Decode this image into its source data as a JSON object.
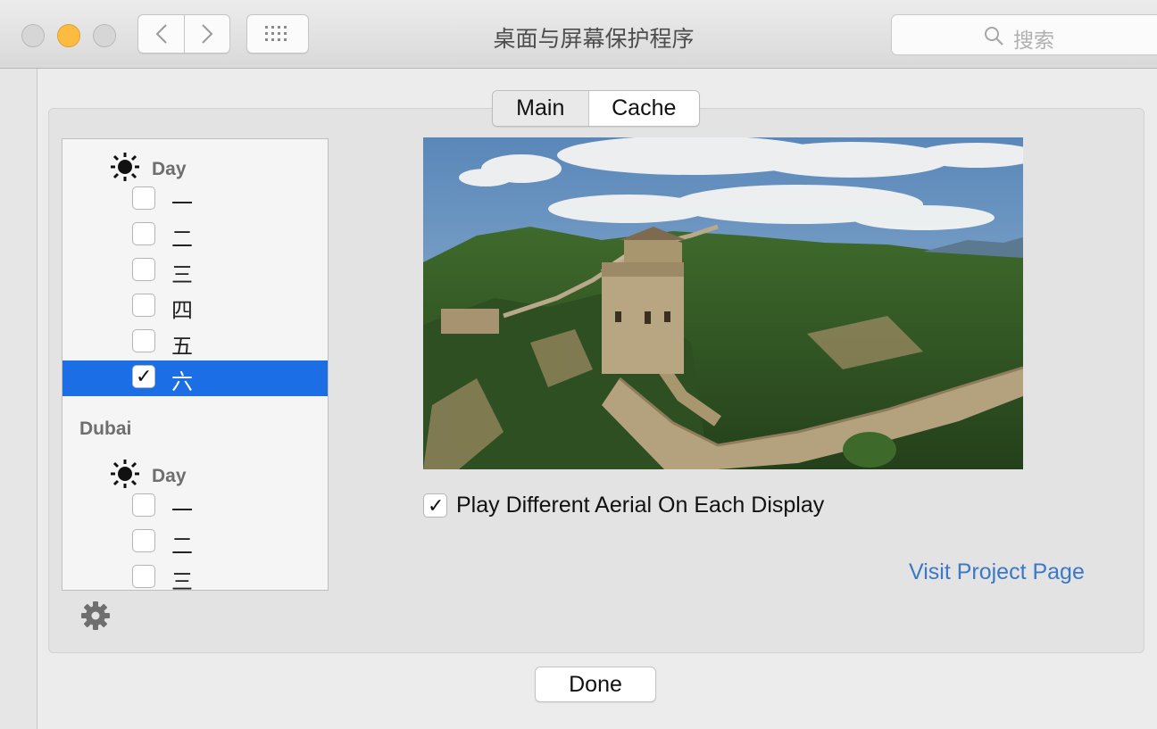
{
  "window": {
    "title": "桌面与屏幕保护程序",
    "search_placeholder": "搜索"
  },
  "tabs": [
    {
      "label": "Main",
      "selected": false
    },
    {
      "label": "Cache",
      "selected": true
    }
  ],
  "list": {
    "sections": [
      {
        "group": "",
        "time_label": "Day",
        "items": [
          {
            "label": "一",
            "checked": false
          },
          {
            "label": "二",
            "checked": false
          },
          {
            "label": "三",
            "checked": false
          },
          {
            "label": "四",
            "checked": false
          },
          {
            "label": "五",
            "checked": false
          },
          {
            "label": "六",
            "checked": true,
            "selected": true
          }
        ]
      },
      {
        "group": "Dubai",
        "time_label": "Day",
        "items": [
          {
            "label": "一",
            "checked": false
          },
          {
            "label": "二",
            "checked": false
          },
          {
            "label": "三",
            "checked": false
          }
        ]
      }
    ]
  },
  "options": {
    "play_different_label": "Play Different Aerial On Each Display",
    "play_different_checked": true,
    "checkmark": "✓"
  },
  "links": {
    "project_page": "Visit Project Page"
  },
  "buttons": {
    "done": "Done"
  },
  "colors": {
    "selection": "#1b6ee3",
    "link": "#3b78c9",
    "minimize_light": "#fdbc40"
  }
}
